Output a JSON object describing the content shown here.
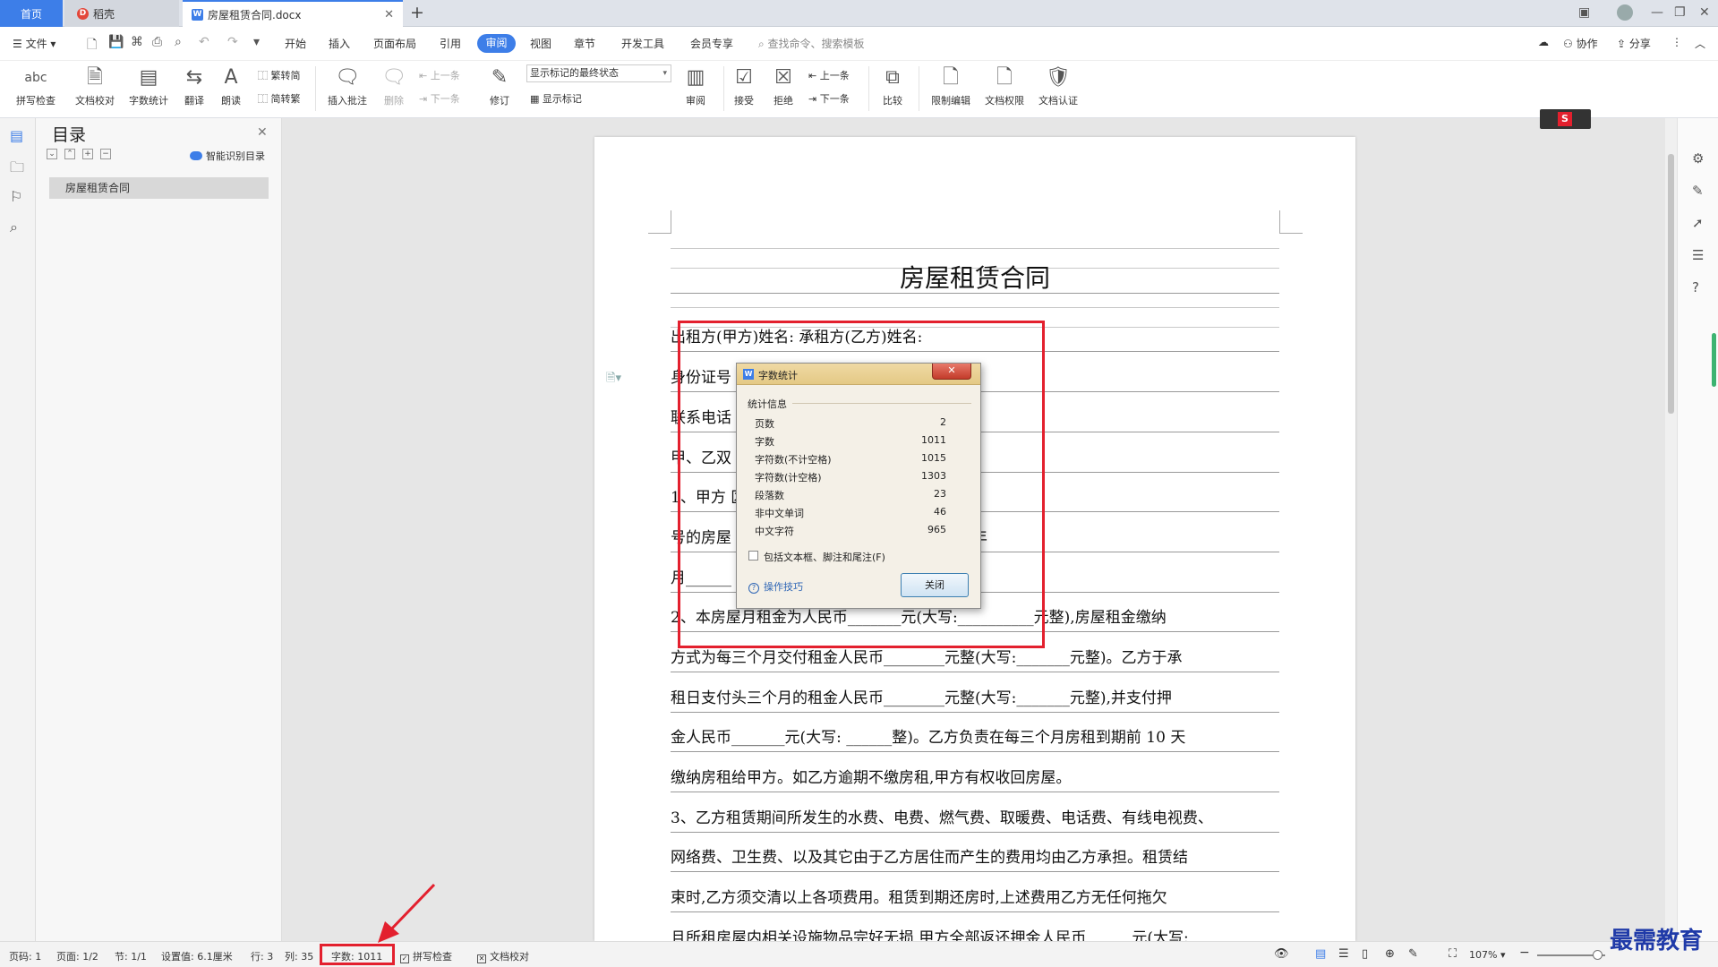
{
  "titlebar": {
    "tabs": [
      {
        "label": "首页"
      },
      {
        "label": "稻壳"
      },
      {
        "label": "房屋租赁合同.docx"
      }
    ]
  },
  "menubar": {
    "file": "文件",
    "items": [
      "开始",
      "插入",
      "页面布局",
      "引用",
      "审阅",
      "视图",
      "章节",
      "开发工具",
      "会员专享"
    ],
    "search_placeholder": "查找命令、搜索模板",
    "collab": "协作",
    "share": "分享"
  },
  "ribbon": {
    "spellcheck": "拼写检查",
    "doc_compare": "文档校对",
    "word_count": "字数统计",
    "translate": "翻译",
    "read_aloud": "朗读",
    "trad_to_simp": "繁转简",
    "simp_to_trad": "简转繁",
    "insert_comment": "插入批注",
    "delete": "删除",
    "prev_comment": "上一条",
    "next_comment": "下一条",
    "revise": "修订",
    "markup_state": "显示标记的最终状态",
    "show_markup": "显示标记",
    "review": "审阅",
    "accept": "接受",
    "reject": "拒绝",
    "prev_change": "上一条",
    "next_change": "下一条",
    "compare": "比较",
    "restrict_edit": "限制编辑",
    "doc_permission": "文档权限",
    "doc_certify": "文档认证"
  },
  "toc": {
    "title": "目录",
    "smart": "智能识别目录",
    "items": [
      "房屋租赁合同"
    ]
  },
  "document": {
    "title": "房屋租赁合同",
    "lines": [
      "出租方(甲方)姓名:                承租方(乙方)姓名:",
      "身份证号                            份证号:",
      "联系电话                            系电话:",
      "甲、乙双                            协议:.",
      "1、甲方                             区______小区______号楼_____单元",
      "号的房屋                            自_____年_____月_____日至______年",
      "月______",
      "2、本房屋月租金为人民币_______元(大写:__________元整),房屋租金缴纳",
      "方式为每三个月交付租金人民币________元整(大写:_______元整)。乙方于承",
      "租日支付头三个月的租金人民币________元整(大写:_______元整),并支付押",
      "金人民币_______元(大写: ______整)。乙方负责在每三个月房租到期前 10 天",
      "缴纳房租给甲方。如乙方逾期不缴房租,甲方有权收回房屋。",
      "3、乙方租赁期间所发生的水费、电费、燃气费、取暖费、电话费、有线电视费、",
      "网络费、卫生费、以及其它由于乙方居住而产生的费用均由乙方承担。租赁结",
      "束时,乙方须交清以上各项费用。租赁到期还房时,上述费用乙方无任何拖欠",
      "且所租房屋内相关设施物品完好无损,甲方全部返还押金人民币______元(大写:"
    ]
  },
  "dialog": {
    "title": "字数统计",
    "close_x": "✕",
    "group_label": "统计信息",
    "stats": [
      {
        "label": "页数",
        "value": "2"
      },
      {
        "label": "字数",
        "value": "1011"
      },
      {
        "label": "字符数(不计空格)",
        "value": "1015"
      },
      {
        "label": "字符数(计空格)",
        "value": "1303"
      },
      {
        "label": "段落数",
        "value": "23"
      },
      {
        "label": "非中文单词",
        "value": "46"
      },
      {
        "label": "中文字符",
        "value": "965"
      }
    ],
    "checkbox_label": "包括文本框、脚注和尾注(F)",
    "tips": "操作技巧",
    "close_button": "关闭"
  },
  "statusbar": {
    "page_num": "页码: 1",
    "page": "页面: 1/2",
    "section": "节: 1/1",
    "setting": "设置值: 6.1厘米",
    "row": "行: 3",
    "col": "列: 35",
    "word_count": "字数: 1011",
    "spellcheck": "拼写检查",
    "doc_compare": "文档校对",
    "zoom": "107%"
  },
  "watermark": "最需教育",
  "colors": {
    "accent": "#3d7ee8",
    "annotation_red": "#e3202e"
  }
}
